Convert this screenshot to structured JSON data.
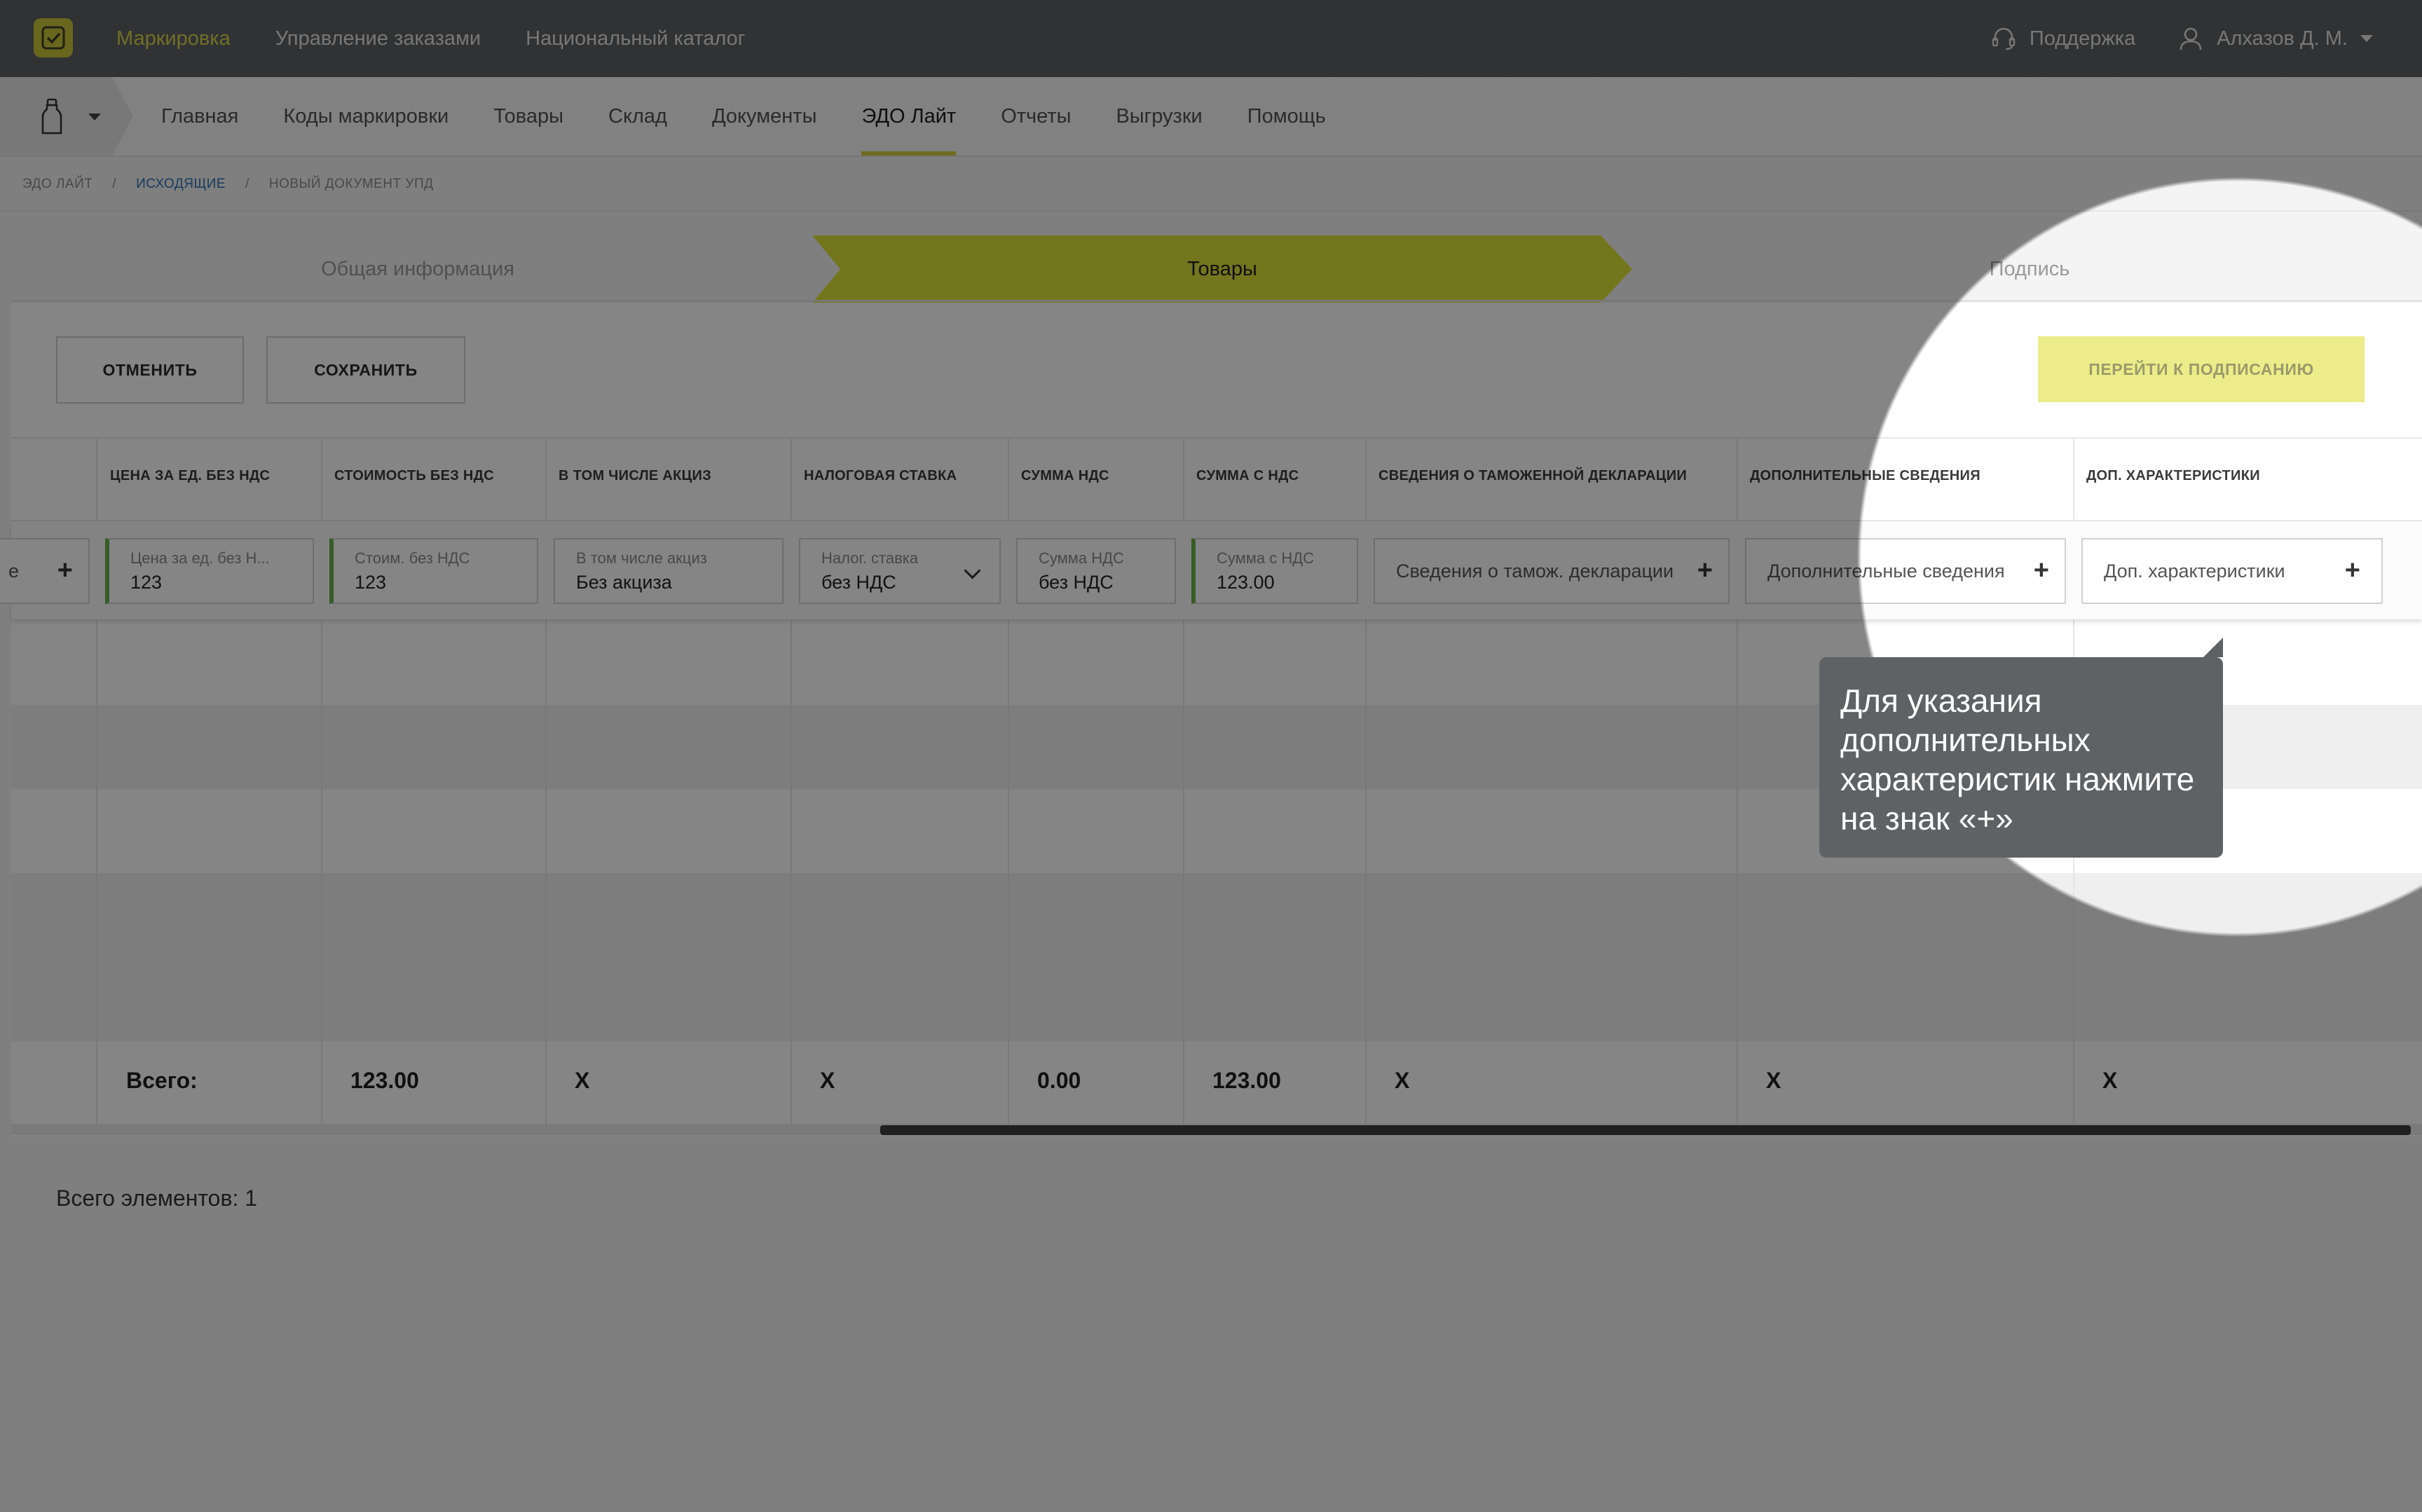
{
  "header": {
    "nav": [
      {
        "label": "Маркировка",
        "active": true
      },
      {
        "label": "Управление заказами",
        "active": false
      },
      {
        "label": "Национальный каталог",
        "active": false
      }
    ],
    "support_label": "Поддержка",
    "user_name": "Алхазов Д. М."
  },
  "subnav": {
    "items": [
      {
        "label": "Главная",
        "active": false
      },
      {
        "label": "Коды маркировки",
        "active": false
      },
      {
        "label": "Товары",
        "active": false
      },
      {
        "label": "Склад",
        "active": false
      },
      {
        "label": "Документы",
        "active": false
      },
      {
        "label": "ЭДО Лайт",
        "active": true
      },
      {
        "label": "Отчеты",
        "active": false
      },
      {
        "label": "Выгрузки",
        "active": false
      },
      {
        "label": "Помощь",
        "active": false
      }
    ]
  },
  "breadcrumb": {
    "items": [
      "ЭДО лайт",
      "Исходящие",
      "Новый документ УПД"
    ],
    "separator": "/"
  },
  "stepper": {
    "steps": [
      {
        "label": "Общая информация",
        "active": false
      },
      {
        "label": "Товары",
        "active": true
      },
      {
        "label": "Подпись",
        "active": false
      }
    ]
  },
  "actions": {
    "cancel_label": "Отменить",
    "save_label": "Сохранить",
    "sign_label": "Перейти к подписанию"
  },
  "table": {
    "columns": [
      "Цена за ед. без НДС",
      "Стоимость без НДС",
      "В том числе акциз",
      "Налоговая ставка",
      "Сумма НДС",
      "Сумма с НДС",
      "Сведения о таможенной декларации",
      "Дополнительные сведения",
      "Доп. характеристики"
    ],
    "input_row": {
      "prev_field_tail": "е",
      "price": {
        "label": "Цена за ед. без Н...",
        "value": "123"
      },
      "cost": {
        "label": "Стоим. без НДС",
        "value": "123"
      },
      "excise": {
        "label": "В том числе акциз",
        "value": "Без акциза"
      },
      "tax_rate": {
        "label": "Налог. ставка",
        "value": "без НДС"
      },
      "vat_sum": {
        "label": "Сумма НДС",
        "value": "без НДС"
      },
      "sum_with_vat": {
        "label": "Сумма с НДС",
        "value": "123.00"
      },
      "customs_placeholder": "Сведения о тамож. декларации",
      "additional_placeholder": "Дополнительные сведения",
      "extra_placeholder": "Доп. характеристики"
    },
    "totals": {
      "label": "Всего:",
      "cost": "123.00",
      "excise": "X",
      "tax_rate": "X",
      "vat_sum": "0.00",
      "sum_with_vat": "123.00",
      "customs": "X",
      "additional": "X",
      "extra": "X"
    },
    "element_count": "Всего элементов: 1"
  },
  "tooltip": {
    "text": "Для указания дополнительных характеристик нажмите на знак «+»"
  },
  "colors": {
    "header_bg": "#5c6064",
    "accent_yellow": "#dfe23a",
    "active_nav": "#d7d44a",
    "link_blue": "#2f6fb0",
    "field_green": "#6ab04c"
  },
  "icons": [
    "app-logo-icon",
    "support-headset-icon",
    "user-icon",
    "bottle-icon",
    "chevron-down-icon",
    "plus-icon"
  ]
}
